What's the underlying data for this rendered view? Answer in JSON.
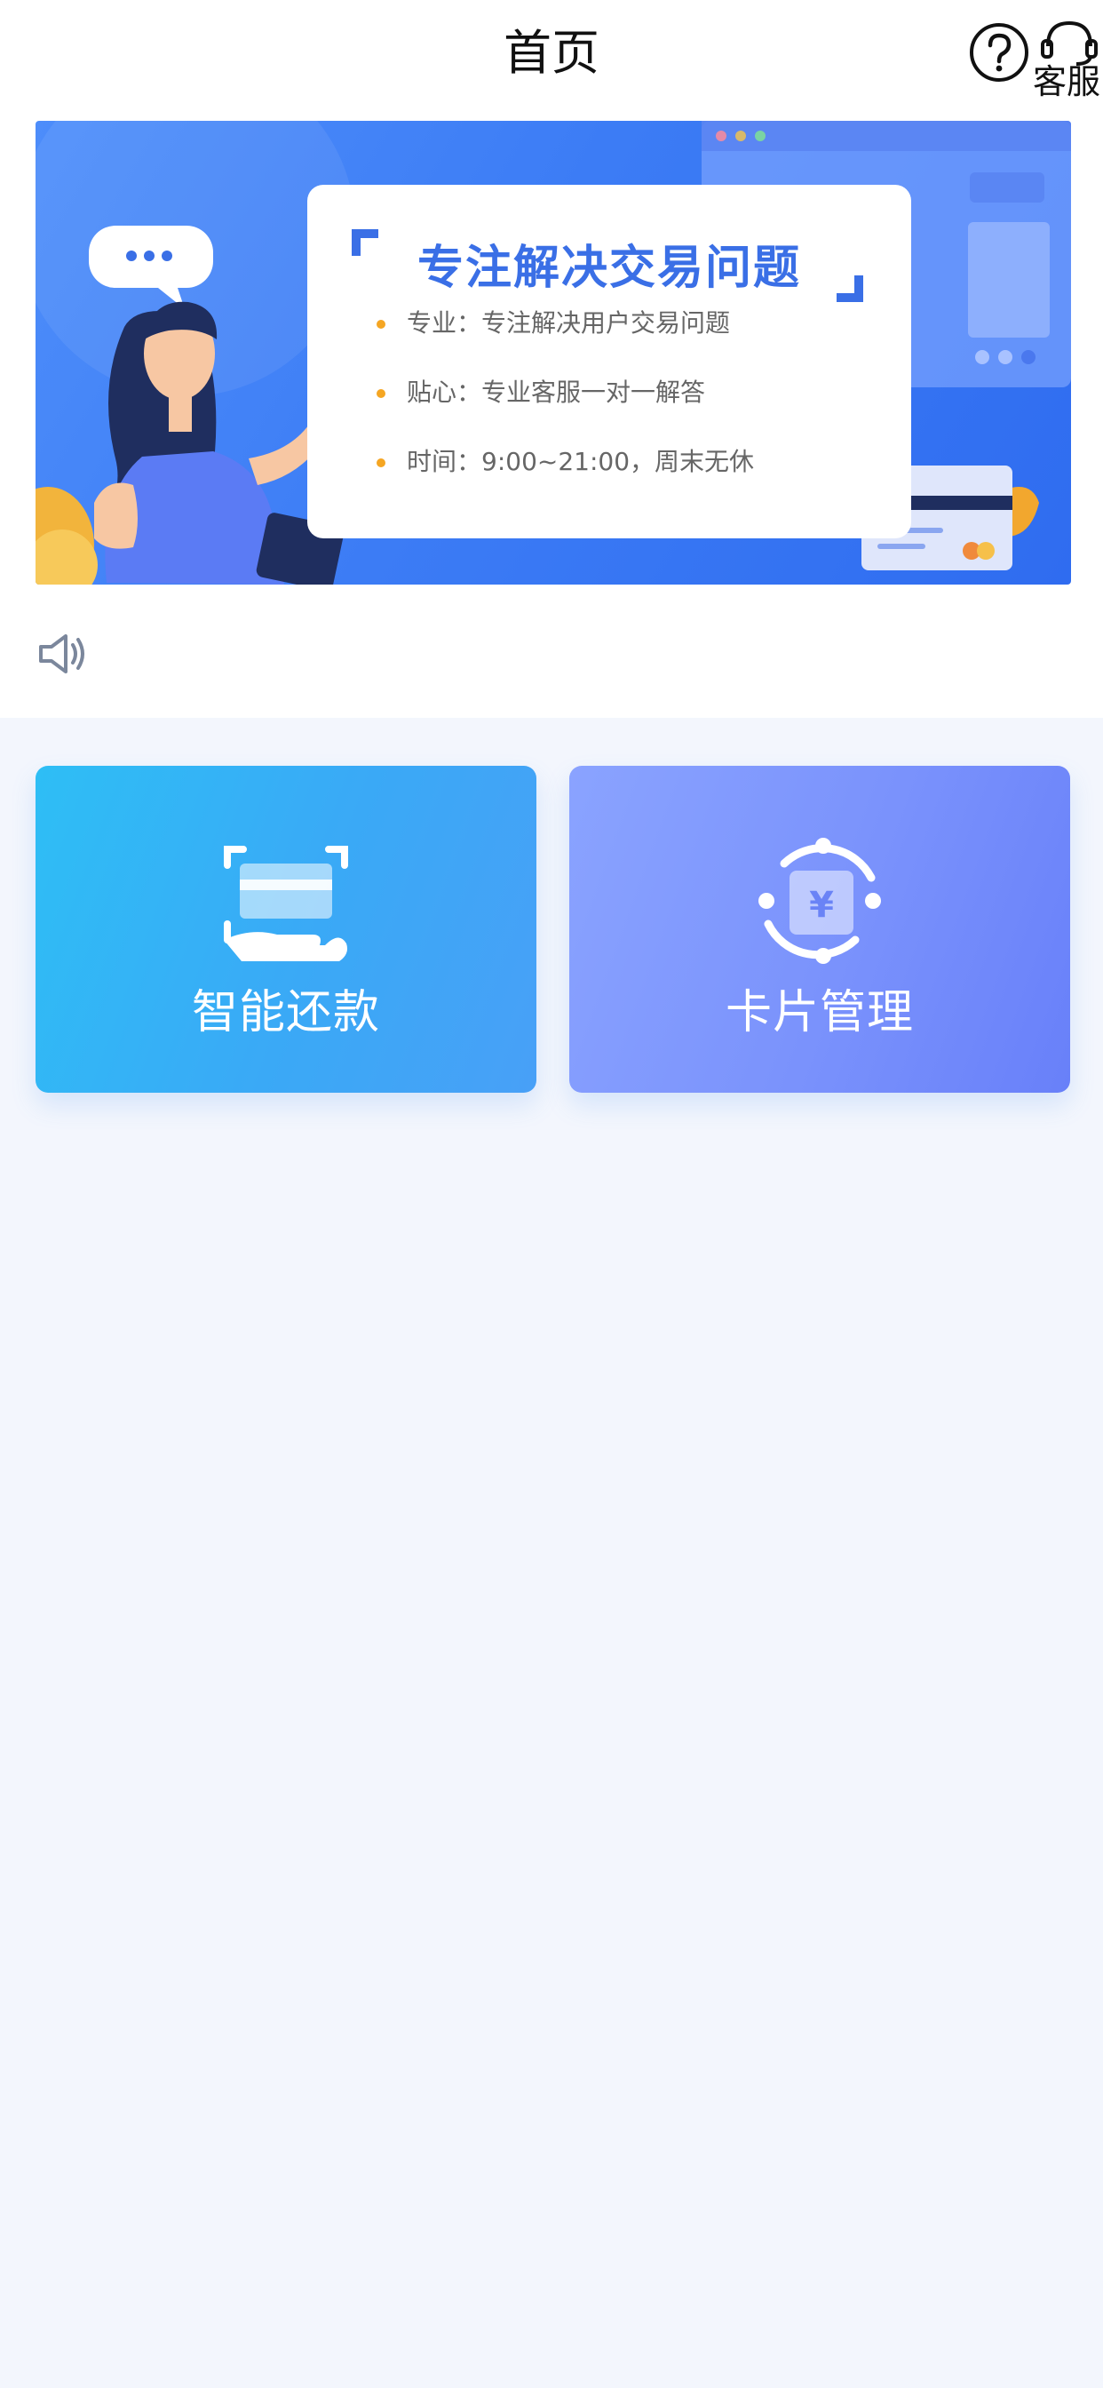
{
  "header": {
    "title": "首页",
    "help_icon": "question-circle-icon",
    "service_icon": "headset-icon",
    "service_label": "客服"
  },
  "banner": {
    "title": "专注解决交易问题",
    "features": [
      "专业：专注解决用户交易问题",
      "贴心：专业客服一对一解答",
      "时间：9:00~21:00，周末无休"
    ],
    "accent_color": "#3a6fe6",
    "background_color": "#3c7cf5"
  },
  "notice": {
    "icon": "speaker-icon"
  },
  "tiles": [
    {
      "label": "智能还款",
      "icon": "card-in-hand-icon",
      "color": "#34b2f5"
    },
    {
      "label": "卡片管理",
      "icon": "yuan-cycle-icon",
      "color": "#7a92fc"
    }
  ],
  "colors": {
    "page_background": "#f3f6fd",
    "top_background": "#ffffff"
  }
}
